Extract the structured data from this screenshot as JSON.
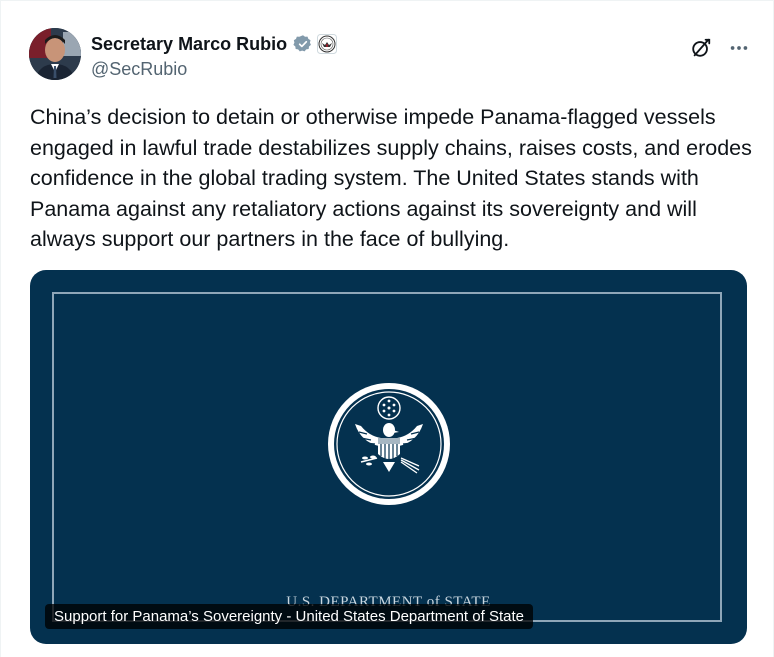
{
  "post": {
    "author": {
      "display_name": "Secretary Marco Rubio",
      "handle": "@SecRubio",
      "verified_badge_icon": "verified-badge-icon",
      "affiliation_icon": "state-department-seal-icon",
      "avatar_icon": "avatar"
    },
    "actions": {
      "grok_icon": "grok-icon",
      "more_icon": "more-icon"
    },
    "text": "China’s decision to detain or otherwise impede Panama-flagged vessels engaged in lawful trade destabilizes supply chains, raises costs, and erodes confidence in the global trading system. The United States stands with Panama against any retaliatory actions against its sovereignty and will always support our partners in the face of bullying.",
    "media": {
      "seal_icon": "great-seal-icon",
      "department_text": "U.S. DEPARTMENT of STATE",
      "caption": "Support for Panama’s Sovereignty - United States Department of State"
    }
  },
  "colors": {
    "media_background": "#04314f",
    "verified_badge": "#829aab",
    "text_primary": "#0f1419",
    "text_secondary": "#536471"
  }
}
